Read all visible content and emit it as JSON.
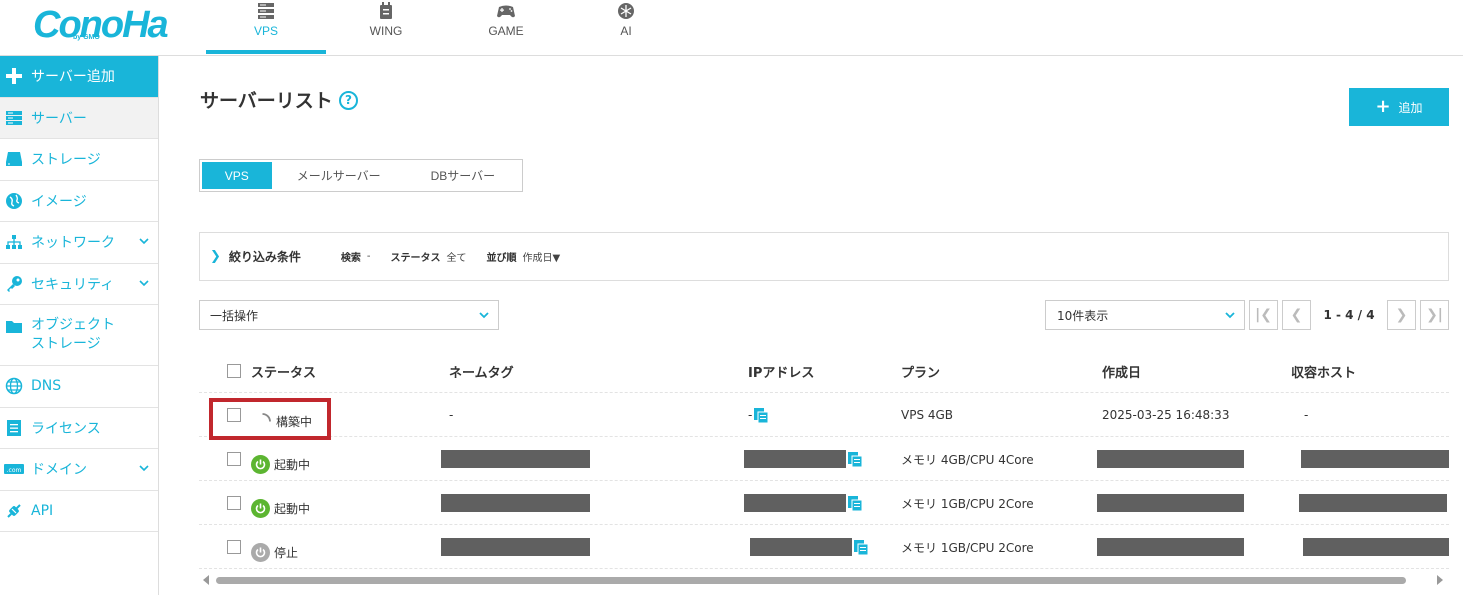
{
  "brand": {
    "logo_text": "ConoHa",
    "logo_sub": "by GMO"
  },
  "service_tabs": [
    {
      "label": "VPS",
      "icon": "server-stack-icon",
      "active": true
    },
    {
      "label": "WING",
      "icon": "wing-icon",
      "active": false
    },
    {
      "label": "GAME",
      "icon": "gamepad-icon",
      "active": false
    },
    {
      "label": "AI",
      "icon": "ai-icon",
      "active": false
    }
  ],
  "sidebar": {
    "items": [
      {
        "label": "サーバー追加",
        "icon": "plus-icon"
      },
      {
        "label": "サーバー",
        "icon": "server-icon"
      },
      {
        "label": "ストレージ",
        "icon": "storage-icon"
      },
      {
        "label": "イメージ",
        "icon": "image-globe-icon"
      },
      {
        "label": "ネットワーク",
        "icon": "network-icon",
        "expandable": true
      },
      {
        "label": "セキュリティ",
        "icon": "key-icon",
        "expandable": true
      },
      {
        "label": "オブジェクト\nストレージ",
        "icon": "folder-icon"
      },
      {
        "label": "DNS",
        "icon": "globe-icon"
      },
      {
        "label": "ライセンス",
        "icon": "license-icon"
      },
      {
        "label": "ドメイン",
        "icon": "domain-icon",
        "expandable": true
      },
      {
        "label": "API",
        "icon": "api-icon"
      }
    ]
  },
  "page": {
    "title": "サーバーリスト",
    "help": "?",
    "add_label": "追加"
  },
  "segment": {
    "tabs": [
      "VPS",
      "メールサーバー",
      "DBサーバー"
    ],
    "active": "VPS"
  },
  "filter": {
    "title": "絞り込み条件",
    "search_label": "検索",
    "search_value": "-",
    "status_label": "ステータス",
    "status_value": "全て",
    "sort_label": "並び順",
    "sort_value": "作成日▼"
  },
  "bulk_action": {
    "value": "一括操作"
  },
  "pagination": {
    "per_page": "10件表示",
    "info": "1 - 4 / 4",
    "first": "|❮",
    "prev": "❮",
    "next": "❯",
    "last": "❯|"
  },
  "table": {
    "columns": [
      "ステータス",
      "ネームタグ",
      "IPアドレス",
      "プラン",
      "作成日",
      "収容ホスト"
    ],
    "rows": [
      {
        "status": "構築中",
        "status_kind": "building",
        "name_tag": "-",
        "ip": "-",
        "plan": "VPS 4GB",
        "created": "2025-03-25 16:48:33",
        "host": "-"
      },
      {
        "status": "起動中",
        "status_kind": "running",
        "name_tag": "",
        "ip": "",
        "plan": "メモリ 4GB/CPU 4Core",
        "created": "",
        "host": ""
      },
      {
        "status": "起動中",
        "status_kind": "running",
        "name_tag": "",
        "ip": "",
        "plan": "メモリ 1GB/CPU 2Core",
        "created": "",
        "host": ""
      },
      {
        "status": "停止",
        "status_kind": "stopped",
        "name_tag": "",
        "ip": "",
        "plan": "メモリ 1GB/CPU 2Core",
        "created": "",
        "host": ""
      }
    ]
  },
  "colors": {
    "accent": "#19b5d9",
    "running": "#5cb531",
    "stopped": "#aaaaaa",
    "highlight": "#c1272d",
    "redaction": "#606060"
  }
}
